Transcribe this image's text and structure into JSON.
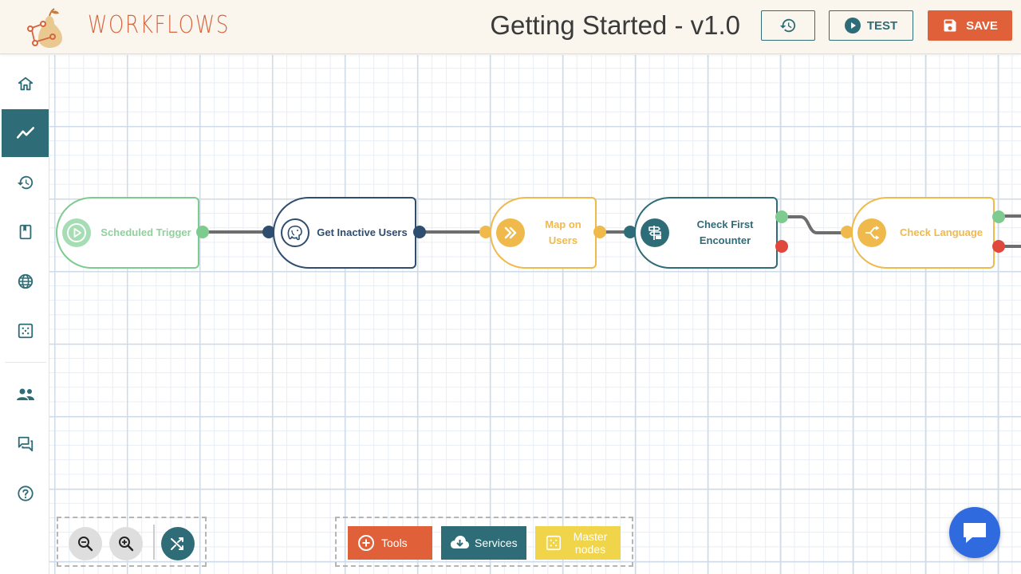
{
  "header": {
    "brand": "WORKFLOWS",
    "title": "Getting Started - v1.0",
    "test_label": "TEST",
    "save_label": "SAVE"
  },
  "sidebar": {
    "items": [
      {
        "name": "home",
        "icon": "home-icon",
        "active": false
      },
      {
        "name": "analytics",
        "icon": "trending-icon",
        "active": true
      },
      {
        "name": "history",
        "icon": "history-icon",
        "active": false
      },
      {
        "name": "bookmarks",
        "icon": "bookmark-icon",
        "active": false
      },
      {
        "name": "web",
        "icon": "globe-icon",
        "active": false
      },
      {
        "name": "grid",
        "icon": "dots-grid-icon",
        "active": false
      },
      {
        "name": "users",
        "icon": "people-icon",
        "active": false
      },
      {
        "name": "chat",
        "icon": "forum-icon",
        "active": false
      },
      {
        "name": "help",
        "icon": "help-icon",
        "active": false
      }
    ]
  },
  "nodes": [
    {
      "label": "Scheduled Trigger",
      "icon": "play-circle-icon",
      "color": "#7ecb8f"
    },
    {
      "label": "Get Inactive Users",
      "icon": "postgres-elephant-icon",
      "color": "#2f4d6e"
    },
    {
      "label": "Map on Users",
      "icon": "double-chevron-right-icon",
      "color": "#f0b94c"
    },
    {
      "label": "Check First Encounter",
      "icon": "signpost-icon",
      "color": "#2e6c77"
    },
    {
      "label": "Check Language",
      "icon": "branch-split-icon",
      "color": "#f0b94c"
    }
  ],
  "toolbar": {
    "tools_label": "Tools",
    "services_label": "Services",
    "master_nodes_label": "Master nodes"
  },
  "colors": {
    "accent_orange": "#e0603a",
    "teal": "#2e6c77",
    "green": "#7ecb8f",
    "yellow": "#f0b94c",
    "navy": "#2f4d6e",
    "error_red": "#e0483e",
    "chat_blue": "#2f6bdf"
  }
}
